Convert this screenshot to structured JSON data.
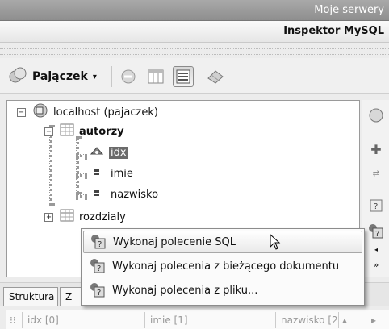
{
  "window": {
    "title": "Moje serwery"
  },
  "panel": {
    "title": "Inspektor MySQL"
  },
  "toolbar": {
    "db_selector_label": "Pajączek"
  },
  "tree": {
    "root_label": "localhost (pajaczek)",
    "tables": [
      {
        "label": "autorzy",
        "expanded": true,
        "columns": [
          "idx",
          "imie",
          "nazwisko"
        ]
      },
      {
        "label": "rozdzialy",
        "expanded": false
      }
    ]
  },
  "tabs": {
    "tab1": "Struktura",
    "tab2": "Z"
  },
  "grid": {
    "headers": [
      "idx [0]",
      "imie [1]",
      "nazwisko [2"
    ]
  },
  "context_menu": {
    "items": [
      {
        "label": "Wykonaj polecenie SQL"
      },
      {
        "label": "Wykonaj polecenia z bieżącego dokumentu"
      },
      {
        "label": "Wykonaj polecenia z pliku..."
      }
    ]
  }
}
